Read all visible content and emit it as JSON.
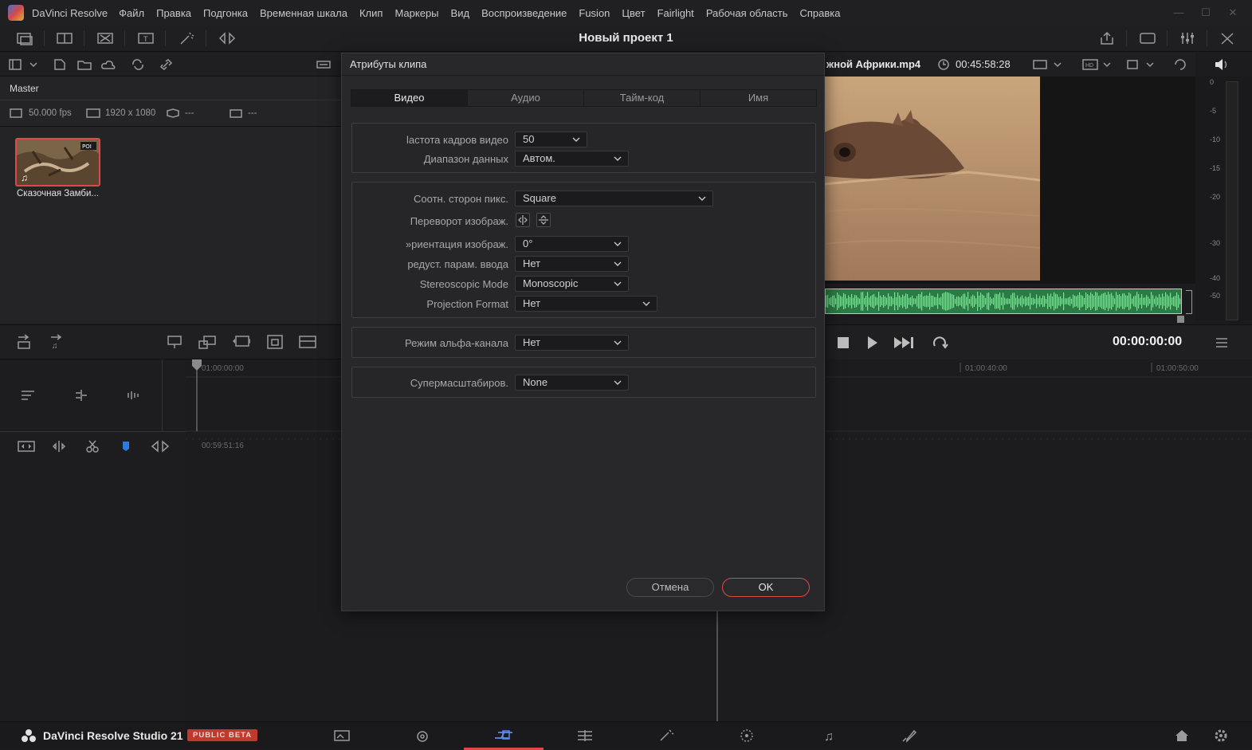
{
  "menubar": {
    "app_name": "DaVinci Resolve",
    "items": [
      "Файл",
      "Правка",
      "Подгонка",
      "Временная шкала",
      "Клип",
      "Маркеры",
      "Вид",
      "Воспроизведение",
      "Fusion",
      "Цвет",
      "Fairlight",
      "Рабочая область",
      "Справка"
    ]
  },
  "project": {
    "title": "Новый проект 1"
  },
  "mediapool": {
    "bin": "Master",
    "fps": "50.000 fps",
    "resolution": "1920 x 1080",
    "codec": "---",
    "extra": "---",
    "clip": {
      "name": "Сказочная Замби...",
      "badge": "POI"
    }
  },
  "viewer": {
    "clip_name": "жной Африки.mp4",
    "duration": "00:45:58:28",
    "timecode": "00:00:00:00"
  },
  "meter": {
    "labels": [
      "0",
      "-5",
      "-10",
      "-15",
      "-20",
      "-30",
      "-40",
      "-50"
    ]
  },
  "timeline": {
    "ruler_start": "01:00:00:00",
    "ruler_mid": "01:00:40:00",
    "ruler_end": "01:00:50:00",
    "lower_start": "00:59:51:16"
  },
  "dialog": {
    "title": "Атрибуты клипа",
    "tabs": [
      "Видео",
      "Аудио",
      "Тайм-код",
      "Имя"
    ],
    "active_tab": "Видео",
    "group1": {
      "frame_rate_label": "lастота кадров видео",
      "frame_rate_value": "50",
      "data_range_label": "Диапазон данных",
      "data_range_value": "Автом."
    },
    "group2": {
      "pixel_aspect_label": "Соотн. сторон пикс.",
      "pixel_aspect_value": "Square",
      "flip_label": "Переворот изображ.",
      "orientation_label": "»риентация изображ.",
      "orientation_value": "0°",
      "input_preset_label": "редуст. парам. ввода",
      "input_preset_value": "Нет",
      "stereo_label": "Stereoscopic Mode",
      "stereo_value": "Monoscopic",
      "projection_label": "Projection Format",
      "projection_value": "Нет"
    },
    "group3": {
      "alpha_label": "Режим альфа-канала",
      "alpha_value": "Нет"
    },
    "group4": {
      "superscale_label": "Супермасштабиров.",
      "superscale_value": "None"
    },
    "cancel": "Отмена",
    "ok": "OK"
  },
  "pagebar": {
    "brand": "DaVinci Resolve Studio 21",
    "badge": "PUBLIC BETA",
    "active_page": "cut"
  },
  "colors": {
    "accent": "#e04848",
    "waveform": "#2c7a45",
    "beta": "#c0392b"
  }
}
